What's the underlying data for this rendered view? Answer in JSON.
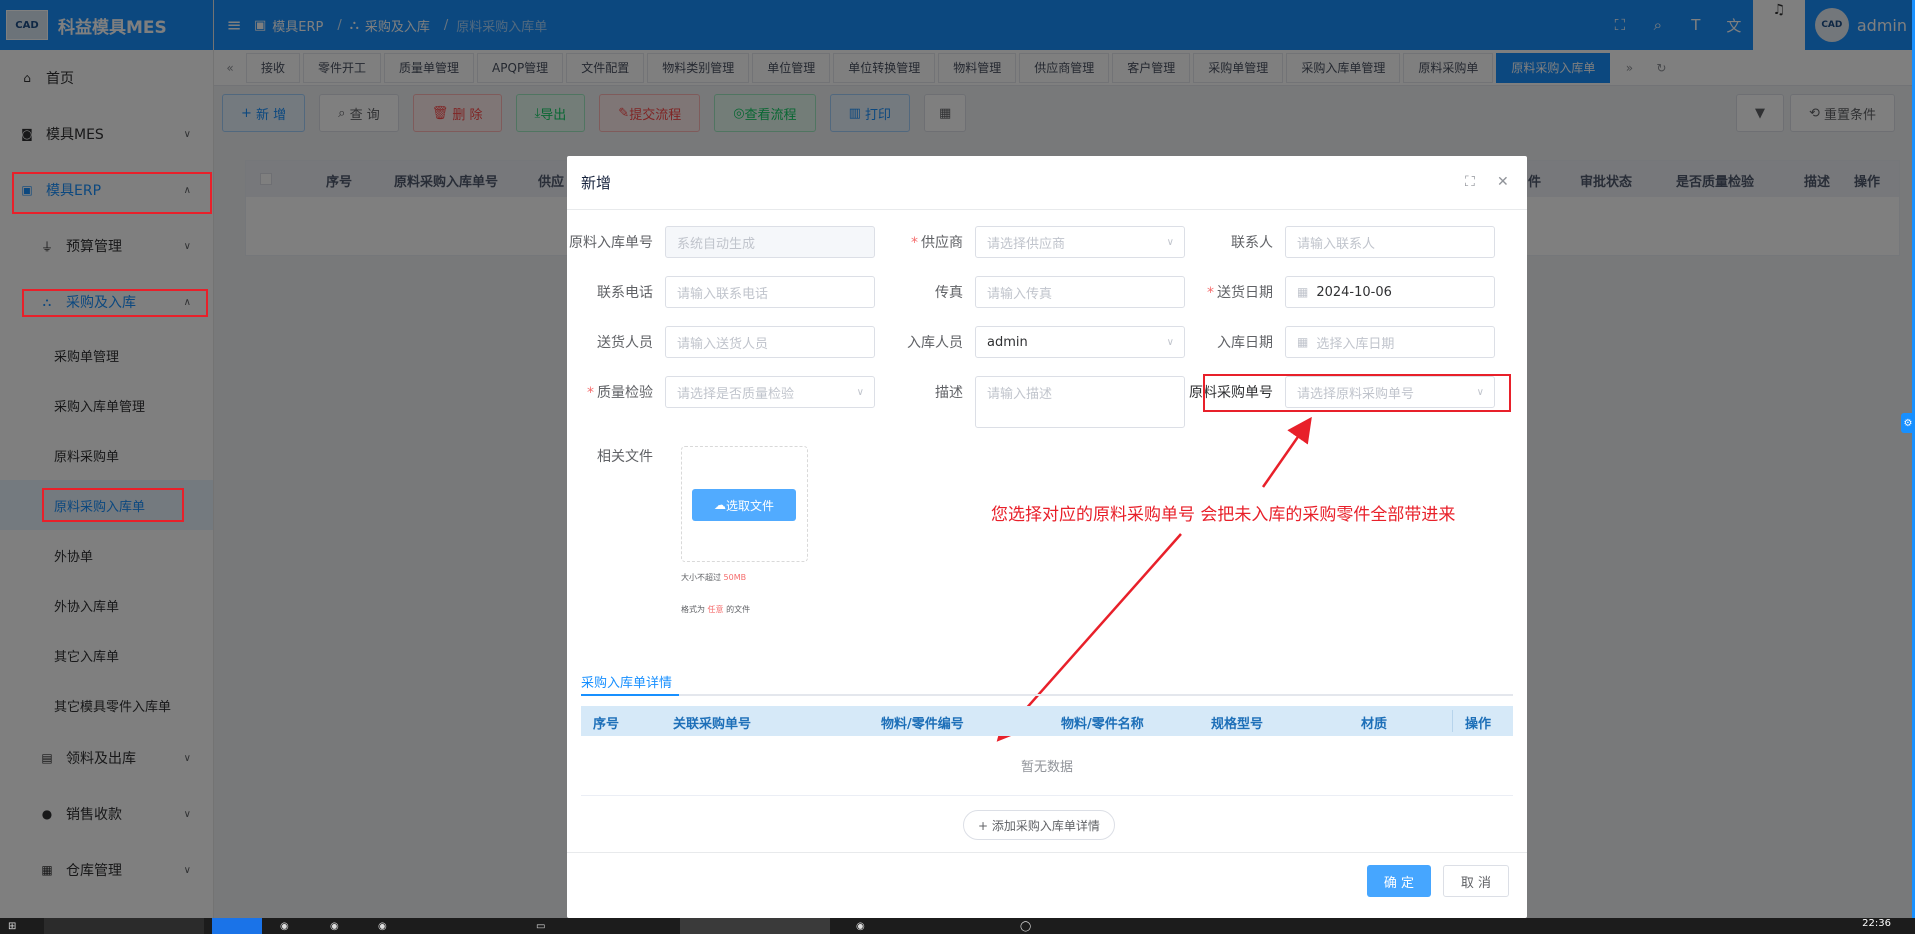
{
  "app": {
    "logo_text": "CAD",
    "title": "科益模具MES"
  },
  "topbar": {
    "breadcrumb": [
      "模具ERP",
      "采购及入库",
      "原料采购入库单"
    ],
    "username": "admin",
    "avatar_text": "CAD"
  },
  "sidebar": {
    "items": [
      {
        "label": "首页",
        "icon": "home-icon"
      },
      {
        "label": "模具MES",
        "icon": "camera-icon"
      },
      {
        "label": "模具ERP",
        "icon": "briefcase-icon"
      },
      {
        "label": "预算管理",
        "icon": "funnel-icon"
      },
      {
        "label": "采购及入库",
        "icon": "nodes-icon"
      },
      {
        "label": "采购单管理"
      },
      {
        "label": "采购入库单管理"
      },
      {
        "label": "原料采购单"
      },
      {
        "label": "原料采购入库单"
      },
      {
        "label": "外协单"
      },
      {
        "label": "外协入库单"
      },
      {
        "label": "其它入库单"
      },
      {
        "label": "其它模具零件入库单"
      },
      {
        "label": "领料及出库",
        "icon": "building-icon"
      },
      {
        "label": "销售收款",
        "icon": "user-icon"
      },
      {
        "label": "仓库管理",
        "icon": "calendar-icon"
      }
    ]
  },
  "tabs": [
    "接收",
    "零件开工",
    "质量单管理",
    "APQP管理",
    "文件配置",
    "物料类别管理",
    "单位管理",
    "单位转换管理",
    "物料管理",
    "供应商管理",
    "客户管理",
    "采购单管理",
    "采购入库单管理",
    "原料采购单",
    "原料采购入库单"
  ],
  "toolbar": {
    "new": "新 增",
    "query": "查 询",
    "delete": "删 除",
    "export": "导出",
    "submit": "提交流程",
    "view": "查看流程",
    "print": "打印",
    "reset": "重置条件"
  },
  "bg_table": {
    "headers": [
      "序号",
      "原料采购入库单号",
      "供应",
      "件",
      "审批状态",
      "是否质量检验",
      "描述",
      "操作"
    ]
  },
  "dialog": {
    "title": "新增",
    "fields": {
      "inbound_no": {
        "label": "原料入库单号",
        "placeholder": "系统自动生成"
      },
      "supplier": {
        "label": "供应商",
        "placeholder": "请选择供应商"
      },
      "contact": {
        "label": "联系人",
        "placeholder": "请输入联系人"
      },
      "phone": {
        "label": "联系电话",
        "placeholder": "请输入联系电话"
      },
      "fax": {
        "label": "传真",
        "placeholder": "请输入传真"
      },
      "delivery_date": {
        "label": "送货日期",
        "value": "2024-10-06"
      },
      "deliverer": {
        "label": "送货人员",
        "placeholder": "请输入送货人员"
      },
      "receiver": {
        "label": "入库人员",
        "value": "admin"
      },
      "inbound_date": {
        "label": "入库日期",
        "placeholder": "选择入库日期"
      },
      "quality": {
        "label": "质量检验",
        "placeholder": "请选择是否质量检验"
      },
      "description": {
        "label": "描述",
        "placeholder": "请输入描述"
      },
      "purchase_no": {
        "label": "原料采购单号",
        "placeholder": "请选择原料采购单号"
      },
      "files": {
        "label": "相关文件"
      }
    },
    "upload": {
      "button": "选取文件",
      "tip_size_prefix": "大小不超过",
      "tip_size_value": "50MB",
      "tip_format_prefix": "格式为",
      "tip_format_value": "任意",
      "tip_format_suffix": "的文件"
    },
    "annotation": "您选择对应的原料采购单号 会把未入库的采购零件全部带进来",
    "detail_tab": "采购入库单详情",
    "detail_headers": [
      "序号",
      "关联采购单号",
      "物料/零件编号",
      "物料/零件名称",
      "规格型号",
      "材质",
      "操作"
    ],
    "empty_text": "暂无数据",
    "add_detail": "+ 添加采购入库单详情",
    "confirm": "确 定",
    "cancel": "取 消"
  },
  "taskbar": {
    "clock": "22:36"
  },
  "colors": {
    "primary": "#1890ff",
    "annotation": "#e8202a"
  }
}
